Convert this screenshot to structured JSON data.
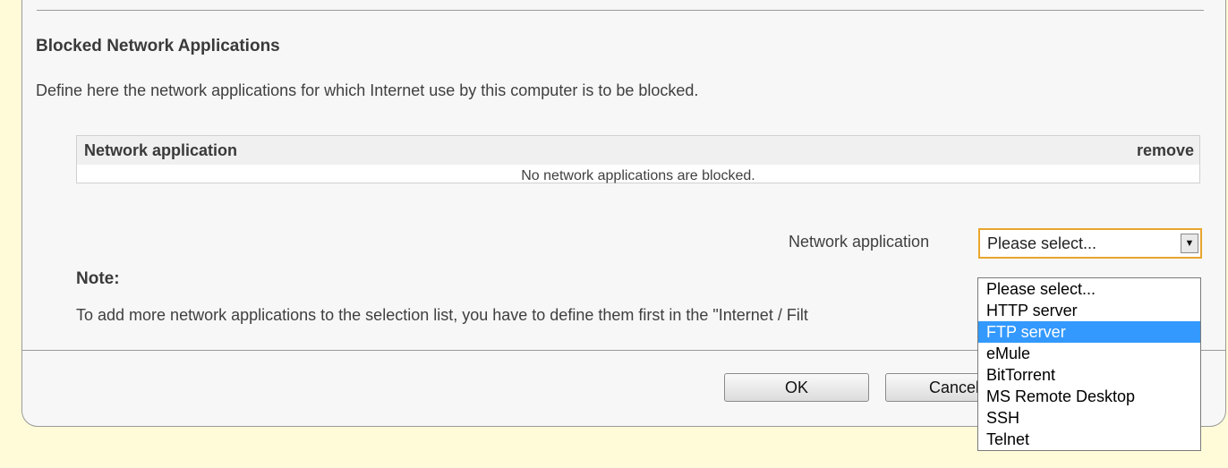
{
  "section": {
    "heading": "Blocked Network Applications",
    "description": "Define here the network applications for which Internet use by this computer is to be blocked."
  },
  "table": {
    "col_name": "Network application",
    "col_remove": "remove",
    "empty_message": "No network applications are blocked."
  },
  "selector": {
    "label": "Network application",
    "value": "Please select...",
    "options": [
      "Please select...",
      "HTTP server",
      "FTP server",
      "eMule",
      "BitTorrent",
      "MS Remote Desktop",
      "SSH",
      "Telnet"
    ],
    "highlighted": "FTP server"
  },
  "note": {
    "title": "Note:",
    "text": "To add more network applications to the selection list, you have to define them first in the \"Internet / Filt"
  },
  "buttons": {
    "ok": "OK",
    "cancel": "Cancel"
  },
  "colors": {
    "background": "#fffbd9",
    "highlight": "#3399ff",
    "select_border": "#e9a52c"
  }
}
